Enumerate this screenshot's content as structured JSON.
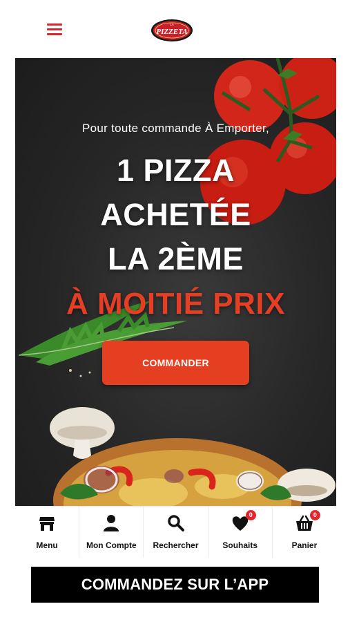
{
  "brand": {
    "logo_text": "PIZZETA",
    "logo_small": "LA"
  },
  "banner": {
    "subtitle": "Pour toute commande À Emporter,",
    "line1": "1 PIZZA",
    "line2": "ACHETÉE",
    "line3": "LA 2ÈME",
    "line4": "À MOITIÉ PRIX",
    "cta_label": "COMMANDER"
  },
  "nav": {
    "items": [
      {
        "label": "Menu",
        "icon": "store-icon"
      },
      {
        "label": "Mon Compte",
        "icon": "user-icon"
      },
      {
        "label": "Rechercher",
        "icon": "search-icon"
      },
      {
        "label": "Souhaits",
        "icon": "heart-icon",
        "badge": "0"
      },
      {
        "label": "Panier",
        "icon": "basket-icon",
        "badge": "0"
      }
    ]
  },
  "app_banner": {
    "label": "COMMANDEZ SUR L’APP"
  },
  "colors": {
    "accent": "#e33f20",
    "brand_red": "#d9262e",
    "banner_bg": "#262626",
    "app_bar": "#000000"
  }
}
